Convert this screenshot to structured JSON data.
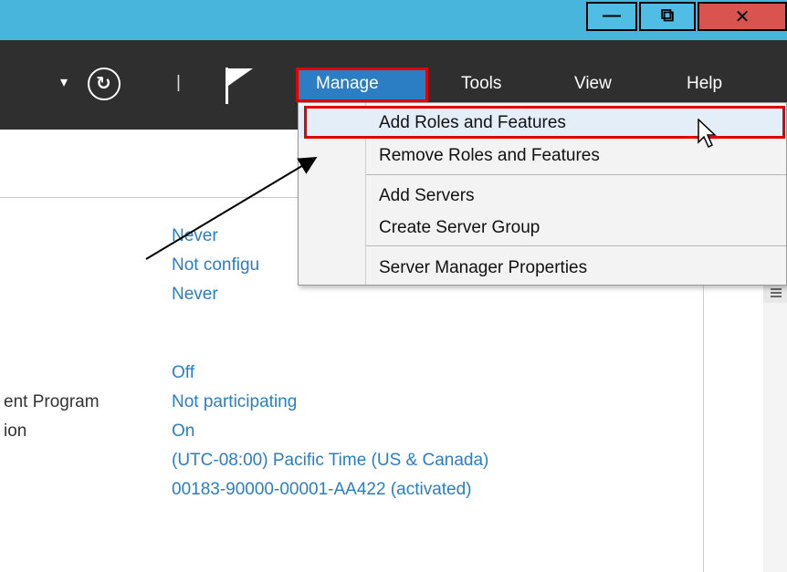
{
  "window": {
    "minimize_glyph": "—",
    "restore_glyph": "⧉",
    "close_glyph": "✕"
  },
  "toolbar": {
    "dropdown_glyph": "▾",
    "refresh_glyph": "↻",
    "separator": "|",
    "manage_label": "Manage",
    "tools_label": "Tools",
    "view_label": "View",
    "help_label": "Help"
  },
  "manage_menu": {
    "items": [
      "Add Roles and Features",
      "Remove Roles and Features",
      "Add Servers",
      "Create Server Group",
      "Server Manager Properties"
    ]
  },
  "properties": {
    "labels": [
      "ent Program",
      "ion"
    ],
    "values": [
      "Never",
      "Not configu",
      "Never",
      "Off",
      "Not participating",
      "On",
      "(UTC-08:00) Pacific Time (US & Canada)",
      "00183-90000-00001-AA422 (activated)"
    ]
  },
  "colors": {
    "accent": "#2b7ec4",
    "highlight": "#e20000",
    "titlebar": "#48b5dd",
    "toolbar": "#2f2f2f"
  }
}
